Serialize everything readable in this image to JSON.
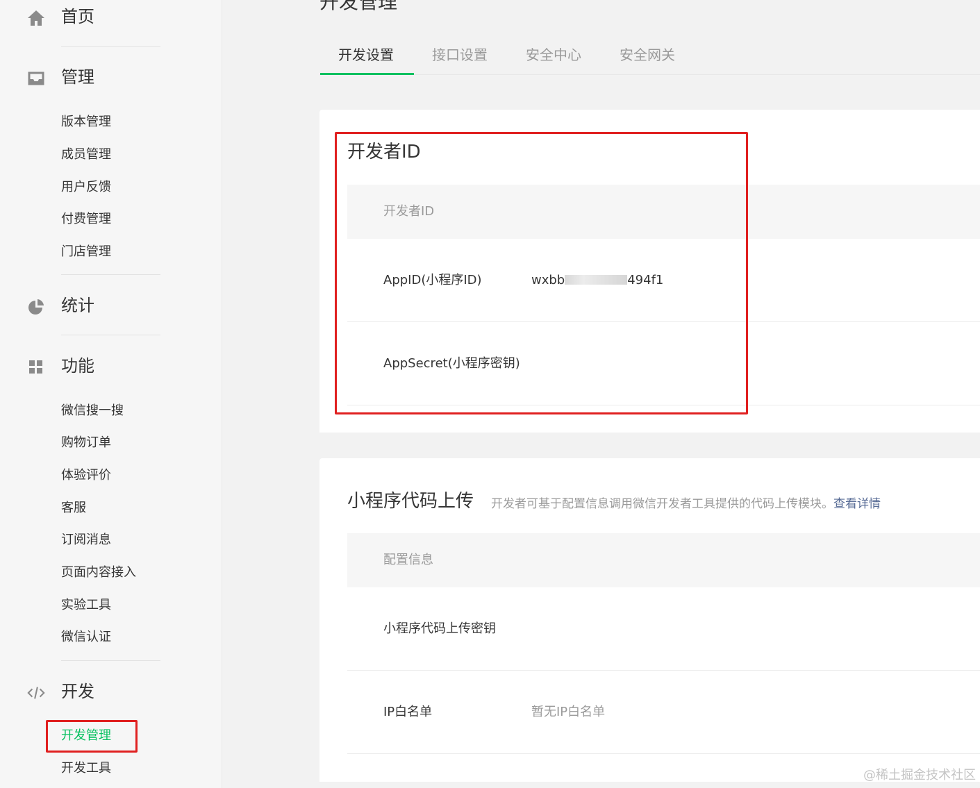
{
  "sidebar": {
    "sections": [
      {
        "icon": "home-icon",
        "title": "首页",
        "items": []
      },
      {
        "icon": "inbox-icon",
        "title": "管理",
        "items": [
          "版本管理",
          "成员管理",
          "用户反馈",
          "付费管理",
          "门店管理"
        ]
      },
      {
        "icon": "pie-chart-icon",
        "title": "统计",
        "items": []
      },
      {
        "icon": "grid-icon",
        "title": "功能",
        "items": [
          "微信搜一搜",
          "购物订单",
          "体验评价",
          "客服",
          "订阅消息",
          "页面内容接入",
          "实验工具",
          "微信认证"
        ]
      },
      {
        "icon": "code-icon",
        "title": "开发",
        "items": [
          "开发管理",
          "开发工具"
        ]
      }
    ],
    "active_item": "开发管理"
  },
  "page_title": "开发管理",
  "tabs": [
    {
      "label": "开发设置",
      "active": true
    },
    {
      "label": "接口设置",
      "active": false
    },
    {
      "label": "安全中心",
      "active": false
    },
    {
      "label": "安全网关",
      "active": false
    }
  ],
  "developer_id_panel": {
    "title": "开发者ID",
    "table_header": "开发者ID",
    "rows": [
      {
        "label": "AppID(小程序ID)",
        "value_prefix": "wxbb",
        "value_suffix": "494f1"
      },
      {
        "label": "AppSecret(小程序密钥)",
        "value": ""
      }
    ]
  },
  "upload_panel": {
    "title": "小程序代码上传",
    "description": "开发者可基于配置信息调用微信开发者工具提供的代码上传模块。",
    "link_label": "查看详情",
    "table_header": "配置信息",
    "rows": [
      {
        "label": "小程序代码上传密钥",
        "value": ""
      },
      {
        "label": "IP白名单",
        "value": "暂无IP白名单"
      }
    ]
  },
  "watermark": "@稀土掘金技术社区",
  "colors": {
    "accent": "#07c160",
    "highlight": "#e02020",
    "link": "#576b95"
  }
}
